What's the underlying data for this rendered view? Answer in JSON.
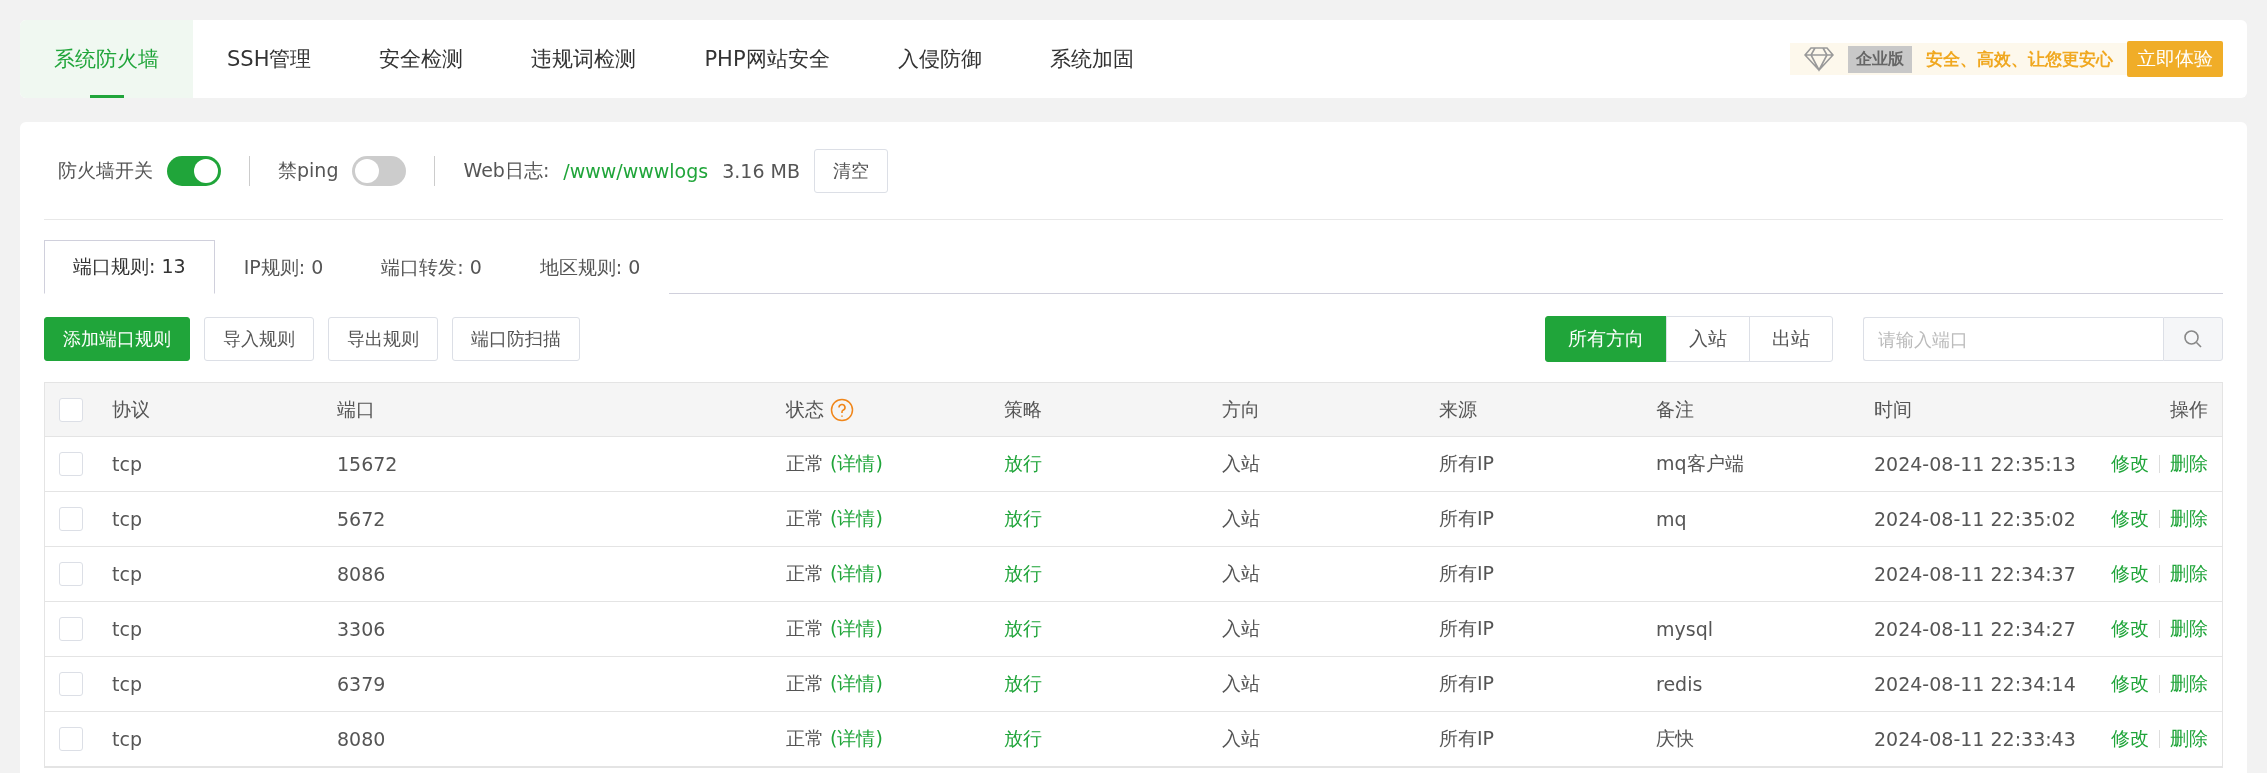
{
  "nav": {
    "tabs": [
      {
        "label": "系统防火墙",
        "selected": true
      },
      {
        "label": "SSH管理",
        "selected": false
      },
      {
        "label": "安全检测",
        "selected": false
      },
      {
        "label": "违规词检测",
        "selected": false
      },
      {
        "label": "PHP网站安全",
        "selected": false
      },
      {
        "label": "入侵防御",
        "selected": false
      },
      {
        "label": "系统加固",
        "selected": false
      }
    ],
    "promo": {
      "edition": "企业版",
      "slogan": "安全、高效、让您更安心",
      "button": "立即体验"
    }
  },
  "settings": {
    "firewall": {
      "label": "防火墙开关",
      "on": true
    },
    "ping": {
      "label": "禁ping",
      "on": false
    },
    "log": {
      "label": "Web日志:",
      "path": "/www/wwwlogs",
      "size": "3.16 MB",
      "button": "清空"
    }
  },
  "rule_tabs": [
    {
      "label": "端口规则: 13",
      "selected": true
    },
    {
      "label": "IP规则: 0",
      "selected": false
    },
    {
      "label": "端口转发: 0",
      "selected": false
    },
    {
      "label": "地区规则: 0",
      "selected": false
    }
  ],
  "actions": [
    {
      "label": "添加端口规则",
      "kind": "primary"
    },
    {
      "label": "导入规则",
      "kind": "plain"
    },
    {
      "label": "导出规则",
      "kind": "plain"
    },
    {
      "label": "端口防扫描",
      "kind": "plain"
    }
  ],
  "direction_filter": [
    {
      "label": "所有方向",
      "selected": true
    },
    {
      "label": "入站",
      "selected": false
    },
    {
      "label": "出站",
      "selected": false
    }
  ],
  "search": {
    "placeholder": "请输入端口"
  },
  "table": {
    "select_all": {
      "checked": false
    },
    "columns": [
      "协议",
      "端口",
      "状态",
      "策略",
      "方向",
      "来源",
      "备注",
      "时间",
      "操作"
    ],
    "rows": [
      {
        "checked": false,
        "protocol": "tcp",
        "port": "15672",
        "status": "正常",
        "detail": "(详情)",
        "policy": "放行",
        "direction": "入站",
        "source": "所有IP",
        "note": "mq客户端",
        "time": "2024-08-11 22:35:13",
        "edit": "修改",
        "delete": "删除"
      },
      {
        "checked": false,
        "protocol": "tcp",
        "port": "5672",
        "status": "正常",
        "detail": "(详情)",
        "policy": "放行",
        "direction": "入站",
        "source": "所有IP",
        "note": "mq",
        "time": "2024-08-11 22:35:02",
        "edit": "修改",
        "delete": "删除"
      },
      {
        "checked": false,
        "protocol": "tcp",
        "port": "8086",
        "status": "正常",
        "detail": "(详情)",
        "policy": "放行",
        "direction": "入站",
        "source": "所有IP",
        "time": "2024-08-11 22:34:37",
        "edit": "修改",
        "delete": "删除"
      },
      {
        "checked": false,
        "protocol": "tcp",
        "port": "3306",
        "status": "正常",
        "detail": "(详情)",
        "policy": "放行",
        "direction": "入站",
        "source": "所有IP",
        "note": "mysql",
        "time": "2024-08-11 22:34:27",
        "edit": "修改",
        "delete": "删除"
      },
      {
        "checked": false,
        "protocol": "tcp",
        "port": "6379",
        "status": "正常",
        "detail": "(详情)",
        "policy": "放行",
        "direction": "入站",
        "source": "所有IP",
        "note": "redis",
        "time": "2024-08-11 22:34:14",
        "edit": "修改",
        "delete": "删除"
      },
      {
        "checked": false,
        "protocol": "tcp",
        "port": "8080",
        "status": "正常",
        "detail": "(详情)",
        "policy": "放行",
        "direction": "入站",
        "source": "所有IP",
        "note": "庆快",
        "time": "2024-08-11 22:33:43",
        "edit": "修改",
        "delete": "删除"
      }
    ]
  }
}
